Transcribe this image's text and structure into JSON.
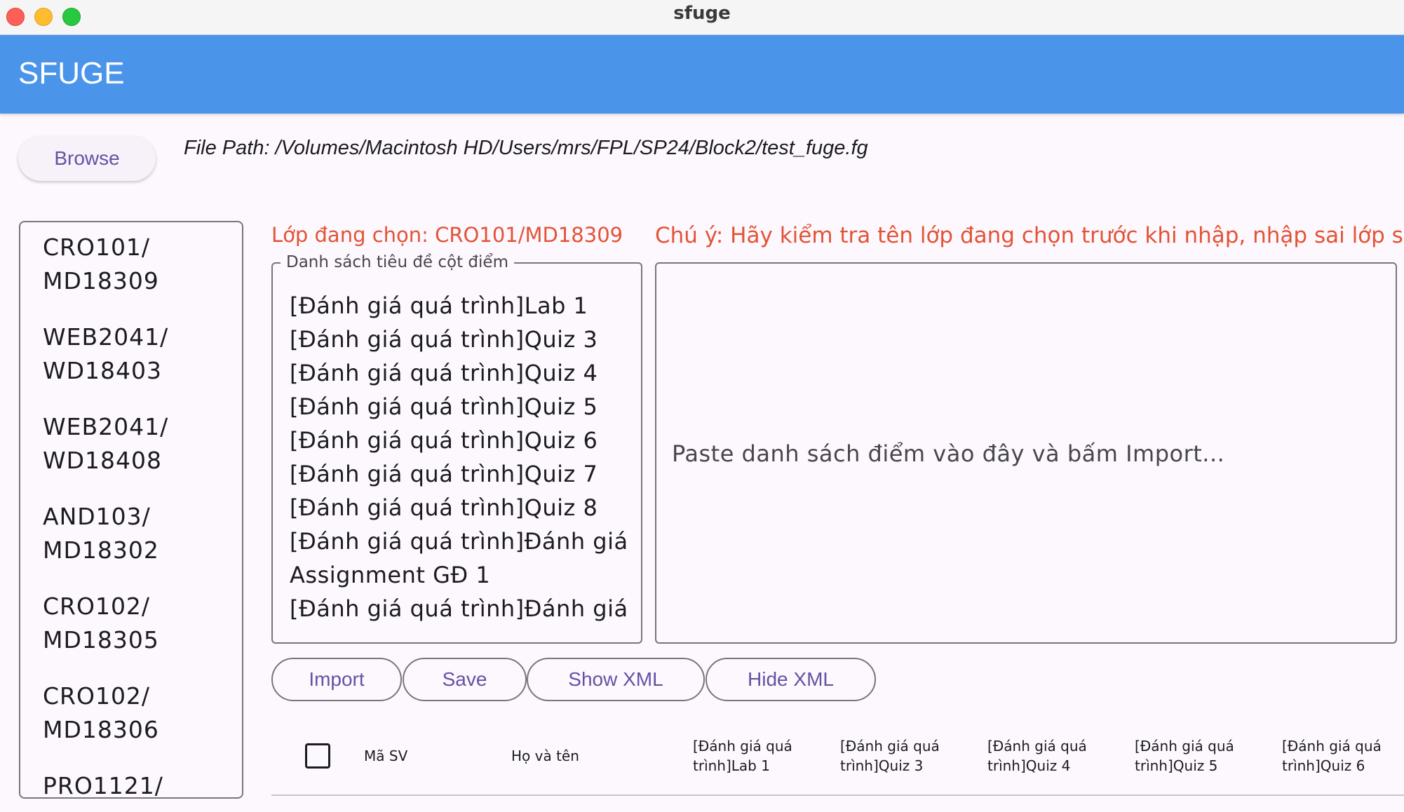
{
  "window": {
    "title": "sfuge"
  },
  "appbar": {
    "title": "SFUGE"
  },
  "toolbar": {
    "browse_label": "Browse",
    "file_path": "File Path: /Volumes/Macintosh HD/Users/mrs/FPL/SP24/Block2/test_fuge.fg"
  },
  "classes": [
    {
      "course": "CRO101/",
      "group": "MD18309"
    },
    {
      "course": "WEB2041/",
      "group": "WD18403"
    },
    {
      "course": "WEB2041/",
      "group": "WD18408"
    },
    {
      "course": "AND103/",
      "group": "MD18302"
    },
    {
      "course": "CRO102/",
      "group": "MD18305"
    },
    {
      "course": "CRO102/",
      "group": "MD18306"
    },
    {
      "course": "PRO1121/",
      "group": ""
    }
  ],
  "selection": {
    "label": "Lớp đang chọn: CRO101/MD18309",
    "warning": "Chú ý: Hãy kiểm tra tên lớp đang chọn trước khi nhập, nhập sai lớp sẽ"
  },
  "headers_box": {
    "legend": "Danh sách tiêu đề cột điểm",
    "lines": [
      "[Đánh giá quá trình]Lab 1",
      "[Đánh giá quá trình]Quiz 3",
      "[Đánh giá quá trình]Quiz 4",
      "[Đánh giá quá trình]Quiz 5",
      "[Đánh giá quá trình]Quiz 6",
      "[Đánh giá quá trình]Quiz 7",
      "[Đánh giá quá trình]Quiz 8",
      "[Đánh giá quá trình]Đánh giá",
      "Assignment GĐ 1",
      "[Đánh giá quá trình]Đánh giá"
    ]
  },
  "paste": {
    "placeholder": "Paste danh sách điểm vào đây và bấm Import..."
  },
  "actions": {
    "import": "Import",
    "save": "Save",
    "show_xml": "Show XML",
    "hide_xml": "Hide XML"
  },
  "table": {
    "columns": [
      {
        "line1": "Mã SV",
        "line2": ""
      },
      {
        "line1": "Họ và tên",
        "line2": ""
      },
      {
        "line1": "[Đánh giá quá",
        "line2": "trình]Lab 1"
      },
      {
        "line1": "[Đánh giá quá",
        "line2": "trình]Quiz 3"
      },
      {
        "line1": "[Đánh giá quá",
        "line2": "trình]Quiz 4"
      },
      {
        "line1": "[Đánh giá quá",
        "line2": "trình]Quiz 5"
      },
      {
        "line1": "[Đánh giá quá",
        "line2": "trình]Quiz 6"
      }
    ]
  }
}
